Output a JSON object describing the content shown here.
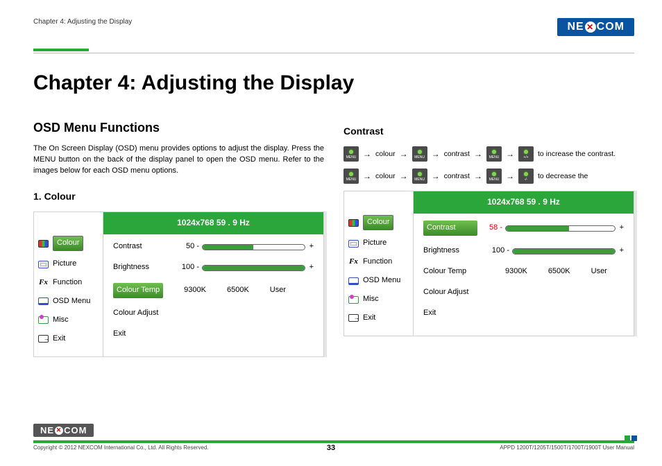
{
  "header": {
    "breadcrumb": "Chapter 4: Adjusting the Display",
    "logo": "NEXCOM"
  },
  "title": "Chapter 4: Adjusting the Display",
  "left": {
    "subhead": "OSD Menu Functions",
    "para": "The On Screen Display (OSD) menu provides options to adjust the display. Press the MENU button on the back of the display panel to open the OSD menu. Refer to the images below for each OSD menu options.",
    "h3": "1. Colour"
  },
  "right": {
    "h3": "Contrast",
    "nav1": {
      "a": "colour",
      "b": "contrast",
      "c": "to increase the contrast."
    },
    "nav2": {
      "a": "colour",
      "b": "contrast",
      "c": "to decrease the"
    }
  },
  "btn": {
    "menu": "MENU",
    "plus": "+/+",
    "minus": "-/-"
  },
  "osd": {
    "header": "1024x768  59 . 9 Hz",
    "side": [
      "Colour",
      "Picture",
      "Function",
      "OSD Menu",
      "Misc",
      "Exit"
    ],
    "contrast": "Contrast",
    "brightness": "Brightness",
    "ctemp": "Colour Temp",
    "cadj": "Colour Adjust",
    "exit": "Exit",
    "temps": [
      "9300K",
      "6500K",
      "User"
    ],
    "v1": {
      "contrast": "50 -",
      "brightness": "100 -"
    },
    "v2": {
      "contrast": "58 -",
      "brightness": "100 -"
    },
    "plus": "+"
  },
  "footer": {
    "copy": "Copyright © 2012 NEXCOM International Co., Ltd. All Rights Reserved.",
    "manual": "APPD 1200T/1205T/1500T/1700T/1900T User Manual",
    "page": "33"
  }
}
